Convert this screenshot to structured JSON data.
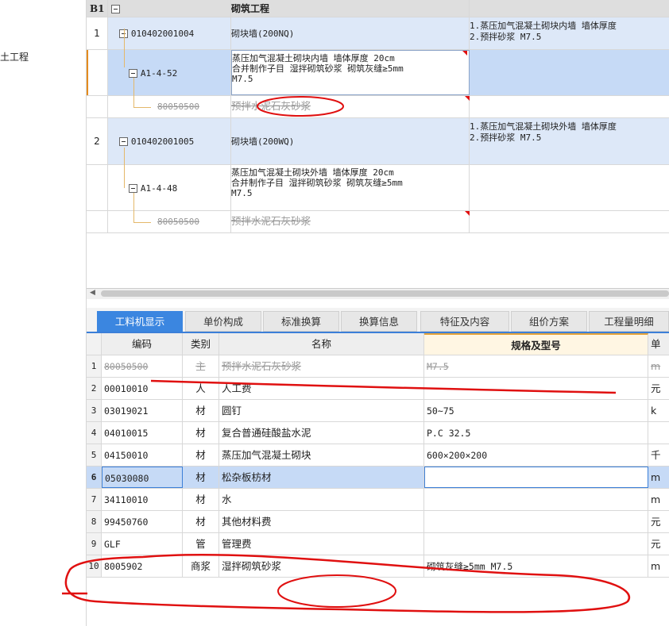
{
  "sidebar": {
    "partial_text": "土工程"
  },
  "top": {
    "header": {
      "code": "B1",
      "name": "砌筑工程"
    },
    "rows": [
      {
        "num": "1",
        "code": "010402001004",
        "name": "砌块墙(200NQ)",
        "feature1": "1.蒸压加气混凝土砌块内墙 墙体厚度",
        "feature2": "2.预拌砂浆 M7.5"
      },
      {
        "code": "A1-4-52",
        "name1": "蒸压加气混凝土砌块内墙 墙体厚度 20cm",
        "name2": "合并制作子目 湿拌砌筑砂浆 砌筑灰缝≥5mm",
        "name3": "M7.5"
      },
      {
        "code": "80050500",
        "name": "预拌水泥石灰砂浆"
      },
      {
        "num": "2",
        "code": "010402001005",
        "name": "砌块墙(200WQ)",
        "feature1": "1.蒸压加气混凝土砌块外墙 墙体厚度",
        "feature2": "2.预拌砂浆 M7.5"
      },
      {
        "code": "A1-4-48",
        "name1": "蒸压加气混凝土砌块外墙 墙体厚度 20cm",
        "name2": "合并制作子目 湿拌砌筑砂浆 砌筑灰缝≥5mm",
        "name3": "M7.5"
      },
      {
        "code": "80050500",
        "name": "预拌水泥石灰砂浆"
      }
    ]
  },
  "tabs": [
    "工料机显示",
    "单价构成",
    "标准换算",
    "换算信息",
    "特征及内容",
    "组价方案",
    "工程量明细"
  ],
  "bottom": {
    "headers": {
      "code": "编码",
      "type": "类别",
      "name": "名称",
      "spec": "规格及型号",
      "unit": "单"
    },
    "rows": [
      {
        "num": "1",
        "code": "80050500",
        "type": "主",
        "name": "预拌水泥石灰砂浆",
        "spec": "M7.5",
        "unit": "m"
      },
      {
        "num": "2",
        "code": "00010010",
        "type": "人",
        "name": "人工费",
        "spec": "",
        "unit": "元"
      },
      {
        "num": "3",
        "code": "03019021",
        "type": "材",
        "name": "圆钉",
        "spec": "50~75",
        "unit": "k"
      },
      {
        "num": "4",
        "code": "04010015",
        "type": "材",
        "name": "复合普通硅酸盐水泥",
        "spec": "P.C 32.5",
        "unit": ""
      },
      {
        "num": "5",
        "code": "04150010",
        "type": "材",
        "name": "蒸压加气混凝土砌块",
        "spec": "600×200×200",
        "unit": "千"
      },
      {
        "num": "6",
        "code": "05030080",
        "type": "材",
        "name": "松杂板枋材",
        "spec": "",
        "unit": "m"
      },
      {
        "num": "7",
        "code": "34110010",
        "type": "材",
        "name": "水",
        "spec": "",
        "unit": "m"
      },
      {
        "num": "8",
        "code": "99450760",
        "type": "材",
        "name": "其他材料费",
        "spec": "",
        "unit": "元"
      },
      {
        "num": "9",
        "code": "GLF",
        "type": "管",
        "name": "管理费",
        "spec": "",
        "unit": "元"
      },
      {
        "num": "10",
        "code": "8005902",
        "type": "商浆",
        "name": "湿拌砌筑砂浆",
        "spec": "砌筑灰缝≥5mm M7.5",
        "unit": "m"
      }
    ]
  },
  "colors": {
    "accent": "#3b86e0",
    "selection": "#c6daf6",
    "annotation": "#e01010"
  }
}
